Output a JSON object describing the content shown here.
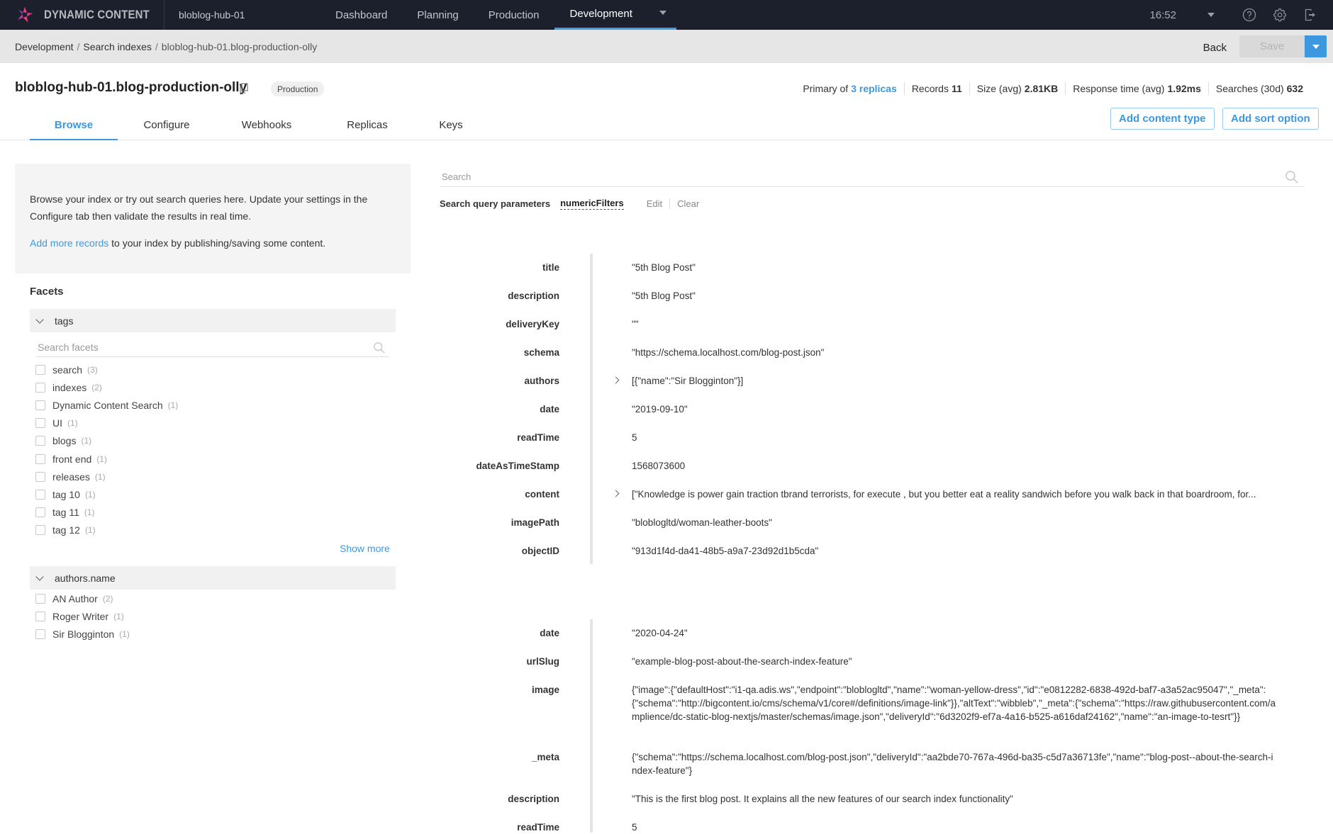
{
  "app": {
    "brand": "DYNAMIC CONTENT",
    "hub": "bloblog-hub-01",
    "nav": [
      "Dashboard",
      "Planning",
      "Production",
      "Development"
    ],
    "nav_active": "Development",
    "clock": "16:52",
    "icons": [
      "help-icon",
      "settings-icon",
      "logout-icon"
    ]
  },
  "breadcrumb": {
    "items": [
      "Development",
      "Search indexes",
      "bloblog-hub-01.blog-production-olly"
    ],
    "separator": "/"
  },
  "actions": {
    "back": "Back",
    "save": "Save"
  },
  "index": {
    "title": "bloblog-hub-01.blog-production-olly",
    "env_badge": "Production",
    "stats": {
      "primary_of_label": "Primary of",
      "replicas": "3 replicas",
      "records_label": "Records",
      "records": "11",
      "size_label": "Size (avg)",
      "size": "2.81KB",
      "response_label": "Response time (avg)",
      "response": "1.92ms",
      "searches_label": "Searches (30d)",
      "searches": "632"
    },
    "add_content_type": "Add content type",
    "add_sort_option": "Add sort option"
  },
  "tabs": [
    "Browse",
    "Configure",
    "Webhooks",
    "Replicas",
    "Keys"
  ],
  "active_tab": "Browse",
  "info": {
    "line1": "Browse your index or try out search queries here. Update your settings in the Configure tab then validate the results in real time.",
    "link": "Add more records",
    "line2_rest": " to your index by publishing/saving some content."
  },
  "facets": {
    "title": "Facets",
    "groups": [
      {
        "name": "tags",
        "search_placeholder": "Search facets",
        "items": [
          {
            "label": "search",
            "count": "(3)"
          },
          {
            "label": "indexes",
            "count": "(2)"
          },
          {
            "label": "Dynamic Content Search",
            "count": "(1)"
          },
          {
            "label": "UI",
            "count": "(1)"
          },
          {
            "label": "blogs",
            "count": "(1)"
          },
          {
            "label": "front end",
            "count": "(1)"
          },
          {
            "label": "releases",
            "count": "(1)"
          },
          {
            "label": "tag 10",
            "count": "(1)"
          },
          {
            "label": "tag 11",
            "count": "(1)"
          },
          {
            "label": "tag 12",
            "count": "(1)"
          }
        ],
        "show_more": "Show more"
      },
      {
        "name": "authors.name",
        "items": [
          {
            "label": "AN Author",
            "count": "(2)"
          },
          {
            "label": "Roger Writer",
            "count": "(1)"
          },
          {
            "label": "Sir Blogginton",
            "count": "(1)"
          }
        ]
      }
    ]
  },
  "search": {
    "placeholder": "Search",
    "value": "",
    "query_params_label": "Search query parameters",
    "active_param": "numericFilters",
    "edit": "Edit",
    "clear": "Clear"
  },
  "records": [
    {
      "fields": [
        {
          "key": "title",
          "value": "\"5th Blog Post\""
        },
        {
          "key": "description",
          "value": "\"5th Blog Post\""
        },
        {
          "key": "deliveryKey",
          "value": "\"\""
        },
        {
          "key": "schema",
          "value": "\"https://schema.localhost.com/blog-post.json\""
        },
        {
          "key": "authors",
          "value": "[{\"name\":\"Sir Blogginton\"}]",
          "expandable": true
        },
        {
          "key": "date",
          "value": "\"2019-09-10\""
        },
        {
          "key": "readTime",
          "value": "5"
        },
        {
          "key": "dateAsTimeStamp",
          "value": "1568073600"
        },
        {
          "key": "content",
          "value": "[\"Knowledge is power gain traction tbrand terrorists, for execute , but you better eat a reality sandwich before you walk back in that boardroom, for...",
          "expandable": true
        },
        {
          "key": "imagePath",
          "value": "\"bloblogltd/woman-leather-boots\""
        },
        {
          "key": "objectID",
          "value": "\"913d1f4d-da41-48b5-a9a7-23d92d1b5cda\""
        }
      ]
    },
    {
      "fields": [
        {
          "key": "date",
          "value": "\"2020-04-24\""
        },
        {
          "key": "urlSlug",
          "value": "\"example-blog-post-about-the-search-index-feature\""
        },
        {
          "key": "image",
          "value": "{\"image\":{\"defaultHost\":\"i1-qa.adis.ws\",\"endpoint\":\"bloblogltd\",\"name\":\"woman-yellow-dress\",\"id\":\"e0812282-6838-492d-baf7-a3a52ac95047\",\"_meta\":{\"schema\":\"http://bigcontent.io/cms/schema/v1/core#/definitions/image-link\"}},\"altText\":\"wibbleb\",\"_meta\":{\"schema\":\"https://raw.githubusercontent.com/amplience/dc-static-blog-nextjs/master/schemas/image.json\",\"deliveryId\":\"6d3202f9-ef7a-4a16-b525-a616daf24162\",\"name\":\"an-image-to-tesrt\"}}"
        },
        {
          "key": "_meta",
          "value": "{\"schema\":\"https://schema.localhost.com/blog-post.json\",\"deliveryId\":\"aa2bde70-767a-496d-ba35-c5d7a36713fe\",\"name\":\"blog-post--about-the-search-index-feature\"}"
        },
        {
          "key": "description",
          "value": "\"This is the first blog post. It explains all the new features of our search index functionality\""
        },
        {
          "key": "readTime",
          "value": "5"
        }
      ]
    }
  ],
  "colors": {
    "accent": "#3d98e0",
    "topbar": "#1b202c",
    "brand_pink": "#e8407a",
    "brand_purple": "#8a3fb0"
  }
}
